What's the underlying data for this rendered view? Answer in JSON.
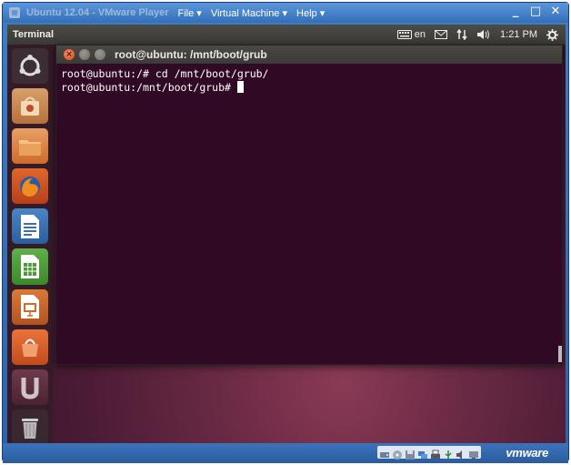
{
  "vmware": {
    "title": "Ubuntu 12.04 - VMware Player",
    "menu": [
      {
        "label": "File ▾"
      },
      {
        "label": "Virtual Machine ▾"
      },
      {
        "label": "Help ▾"
      }
    ],
    "brand": "vmware",
    "accent_color": "#336fb8"
  },
  "panel": {
    "title": "Terminal",
    "keyboard_layout": "en",
    "clock": "1:21 PM"
  },
  "launcher": {
    "items": [
      {
        "icon": "ubuntu-dash-icon"
      },
      {
        "icon": "ubuntu-software-center-icon"
      },
      {
        "icon": "home-folder-icon"
      },
      {
        "icon": "firefox-icon"
      },
      {
        "icon": "libreoffice-writer-icon"
      },
      {
        "icon": "libreoffice-calc-icon"
      },
      {
        "icon": "libreoffice-impress-icon"
      },
      {
        "icon": "ubuntu-one-icon"
      },
      {
        "icon": "workspace-switcher-icon"
      },
      {
        "icon": "trash-icon"
      }
    ]
  },
  "terminal": {
    "title": "root@ubuntu: /mnt/boot/grub",
    "lines": [
      "root@ubuntu:/# cd /mnt/boot/grub/",
      "root@ubuntu:/mnt/boot/grub# "
    ],
    "background_color": "#300a24"
  }
}
